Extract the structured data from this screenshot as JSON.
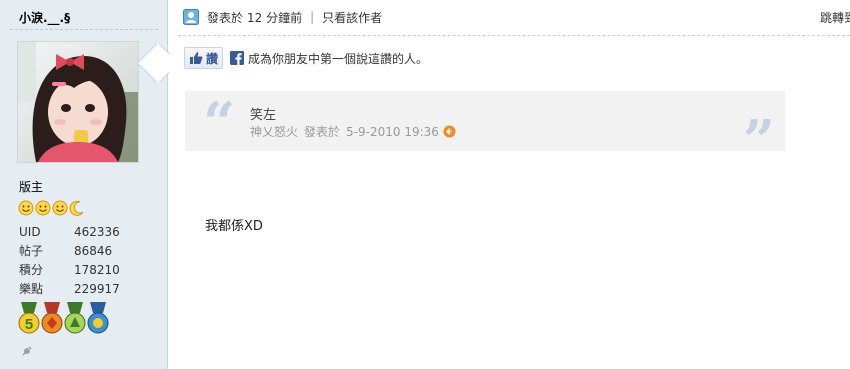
{
  "author": {
    "username": "小淚.__.§",
    "rank": "版主",
    "stats": [
      {
        "label": "UID",
        "value": "462336"
      },
      {
        "label": "帖子",
        "value": "86846"
      },
      {
        "label": "積分",
        "value": "178210"
      },
      {
        "label": "樂點",
        "value": "229917"
      }
    ],
    "star_icons": [
      "smiley-icon",
      "smiley-icon",
      "smiley-icon",
      "moon-icon"
    ],
    "medal_icons": [
      "medal-5-icon",
      "medal-4-icon",
      "medal-3-icon",
      "medal-2-icon"
    ]
  },
  "post": {
    "posted_prefix": "發表於",
    "posted_time": "12 分鐘前",
    "author_only_link": "只看該作者",
    "jump_label": "跳轉到",
    "like_button_label": "讚",
    "like_text": "成為你朋友中第一個說這讚的人。",
    "quote": {
      "text": "笑左",
      "author": "神乂怒火",
      "posted_prefix": "發表於",
      "date": "5-9-2010 19:36"
    },
    "body": "我都係XD"
  },
  "colors": {
    "sidebar_bg": "#e5edf2",
    "quote_bg": "#f2f2f2",
    "quote_mark": "#c3d3e4",
    "facebook_blue": "#3b5998",
    "reply_icon": "#f08a24"
  }
}
